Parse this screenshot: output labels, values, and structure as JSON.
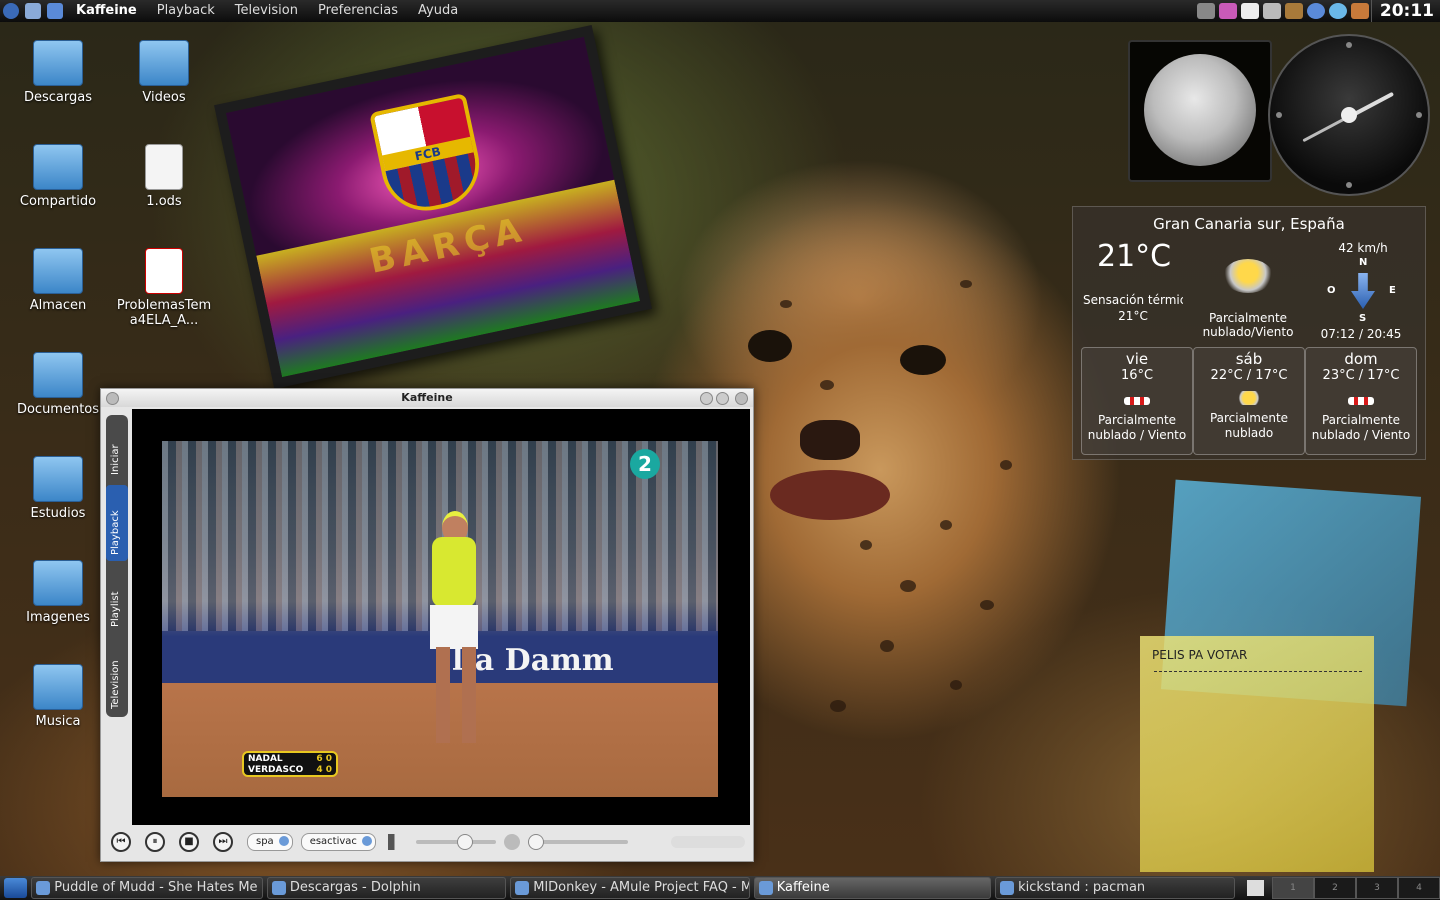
{
  "top_panel": {
    "app_name": "Kaffeine",
    "menu": [
      "Playback",
      "Television",
      "Preferencias",
      "Ayuda"
    ],
    "clock": "20:11"
  },
  "desktop_icons": [
    {
      "label": "Descargas",
      "icon": "folder-download-icon"
    },
    {
      "label": "Videos",
      "icon": "folder-video-icon"
    },
    {
      "label": "Compartido",
      "icon": "folder-network-icon"
    },
    {
      "label": "1.ods",
      "icon": "spreadsheet-file-icon"
    },
    {
      "label": "Almacen",
      "icon": "folder-icon"
    },
    {
      "label": "ProblemasTema4ELA_A...",
      "icon": "pdf-file-icon"
    },
    {
      "label": "Documentos",
      "icon": "folder-documents-icon"
    },
    {
      "label": "Estudios",
      "icon": "folder-edit-icon"
    },
    {
      "label": "Imagenes",
      "icon": "folder-images-icon"
    },
    {
      "label": "Musica",
      "icon": "folder-music-icon"
    }
  ],
  "photo_frame": {
    "crest_text": "FCB",
    "stadium_text": "BARÇA"
  },
  "weather": {
    "location": "Gran Canaria sur, España",
    "temperature": "21°C",
    "feels_like_label": "Sensación térmica",
    "feels_like_value": "21°C",
    "condition": "Parcialmente nublado/Viento",
    "wind_speed": "42 km/h",
    "compass": {
      "n": "N",
      "s": "S",
      "e": "E",
      "w": "O"
    },
    "sunrise_sunset": "07:12 / 20:45",
    "forecast": [
      {
        "day": "vie",
        "temp": "16°C",
        "condition_1": "Parcialmente",
        "condition_2": "nublado / Viento",
        "icon": "wind-icon"
      },
      {
        "day": "sáb",
        "temp": "22°C / 17°C",
        "condition_1": "Parcialmente",
        "condition_2": "nublado",
        "icon": "partly-cloudy-icon"
      },
      {
        "day": "dom",
        "temp": "23°C / 17°C",
        "condition_1": "Parcialmente",
        "condition_2": "nublado / Viento",
        "icon": "wind-icon"
      }
    ]
  },
  "sticky_note": {
    "title": "PELIS PA VOTAR"
  },
  "kaffeine": {
    "title": "Kaffeine",
    "side_tabs": [
      "Iniciar",
      "Playback",
      "Playlist",
      "Television"
    ],
    "active_tab": "Playback",
    "video": {
      "channel": "2",
      "ad_text": "lla Damm",
      "score_p1": "NADAL",
      "score_p1_pts": "6 0",
      "score_p2": "VERDASCO",
      "score_p2_pts": "4 0"
    },
    "audio_track": "spa",
    "subtitle": "esactivac",
    "volume": 0.6
  },
  "taskbar": {
    "tasks": [
      {
        "label": "Puddle of Mudd - She Hates Me - ...",
        "active": false
      },
      {
        "label": "Descargas - Dolphin",
        "active": false
      },
      {
        "label": "MlDonkey - AMule Project FAQ - Mozilla Firefox",
        "active": false
      },
      {
        "label": "Kaffeine",
        "active": true
      },
      {
        "label": "kickstand : pacman",
        "active": false
      }
    ],
    "pager": [
      "1",
      "2",
      "3",
      "4"
    ]
  }
}
